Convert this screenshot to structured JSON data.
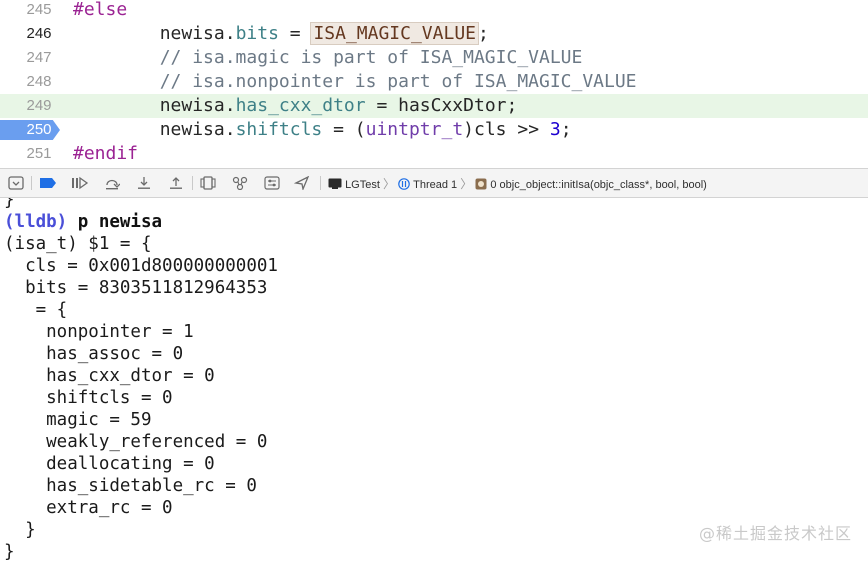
{
  "editor": {
    "lines": [
      {
        "num": "245",
        "parts": [
          {
            "t": "#else",
            "c": "kw"
          }
        ]
      },
      {
        "num": "246",
        "parts": [
          {
            "t": "        newisa.",
            "c": ""
          },
          {
            "t": "bits",
            "c": "prop"
          },
          {
            "t": " = ",
            "c": ""
          },
          {
            "t": "ISA_MAGIC_VALUE",
            "c": "macro"
          },
          {
            "t": ";",
            "c": ""
          }
        ]
      },
      {
        "num": "247",
        "parts": [
          {
            "t": "        // isa.magic is part of ISA_MAGIC_VALUE",
            "c": "cmt"
          }
        ]
      },
      {
        "num": "248",
        "parts": [
          {
            "t": "        // isa.nonpointer is part of ISA_MAGIC_VALUE",
            "c": "cmt"
          }
        ]
      },
      {
        "num": "249",
        "parts": [
          {
            "t": "        newisa.",
            "c": ""
          },
          {
            "t": "has_cxx_dtor",
            "c": "prop"
          },
          {
            "t": " = hasCxxDtor;",
            "c": ""
          }
        ]
      },
      {
        "num": "250",
        "parts": [
          {
            "t": "        newisa.",
            "c": ""
          },
          {
            "t": "shiftcls",
            "c": "prop"
          },
          {
            "t": " = (",
            "c": ""
          },
          {
            "t": "uintptr_t",
            "c": "type"
          },
          {
            "t": ")cls >> ",
            "c": ""
          },
          {
            "t": "3",
            "c": "num"
          },
          {
            "t": ";",
            "c": ""
          }
        ]
      },
      {
        "num": "251",
        "parts": [
          {
            "t": "#endif",
            "c": "kw"
          }
        ]
      }
    ]
  },
  "debugbar": {
    "buttons": [
      {
        "name": "hide-debug-area-button",
        "icon": "panel-toggle-icon"
      },
      {
        "name": "breakpoints-toggle-button",
        "icon": "breakpoint-icon"
      },
      {
        "name": "continue-button",
        "icon": "continue-icon"
      },
      {
        "name": "step-over-button",
        "icon": "step-over-icon"
      },
      {
        "name": "step-into-button",
        "icon": "step-into-icon"
      },
      {
        "name": "step-out-button",
        "icon": "step-out-icon"
      },
      {
        "name": "view-hierarchy-button",
        "icon": "view-hierarchy-icon"
      },
      {
        "name": "memory-graph-button",
        "icon": "memory-graph-icon"
      },
      {
        "name": "environment-overrides-button",
        "icon": "environment-icon"
      },
      {
        "name": "simulate-location-button",
        "icon": "location-icon"
      }
    ],
    "target": "LGTest",
    "thread": "Thread 1",
    "frame": "0 objc_object::initIsa(objc_class*, bool, bool)"
  },
  "console": {
    "lines": [
      "}",
      "(lldb) p newisa",
      "(isa_t) $1 = {",
      "  cls = 0x001d800000000001",
      "  bits = 8303511812964353",
      "   = {",
      "    nonpointer = 1",
      "    has_assoc = 0",
      "    has_cxx_dtor = 0",
      "    shiftcls = 0",
      "    magic = 59",
      "    weakly_referenced = 0",
      "    deallocating = 0",
      "    has_sidetable_rc = 0",
      "    extra_rc = 0",
      "  }",
      "}"
    ],
    "prompt": "(lldb)",
    "command": " p newisa"
  },
  "watermark": "@稀土掘金技术社区"
}
